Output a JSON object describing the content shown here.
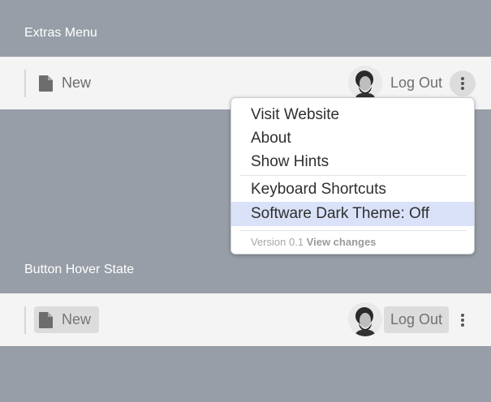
{
  "sections": [
    {
      "label": "Extras Menu",
      "new_label": "New",
      "logout_label": "Log Out",
      "menu_open": true
    },
    {
      "label": "Button Hover State",
      "new_label": "New",
      "logout_label": "Log Out",
      "menu_open": false
    }
  ],
  "dropdown": {
    "items": [
      {
        "label": "Visit Website"
      },
      {
        "label": "About"
      },
      {
        "label": "Show Hints"
      },
      {
        "label": "Keyboard Shortcuts"
      },
      {
        "label": "Software Dark Theme: Off",
        "highlighted": true
      }
    ],
    "version_text": "Version 0.1",
    "changes_link": "View changes"
  },
  "icons": {
    "new": "file-icon",
    "more": "more-vertical-icon",
    "avatar": "user-avatar"
  },
  "colors": {
    "background": "#979ea7",
    "bar": "#f4f4f4",
    "highlight": "#d9e2f8",
    "hover": "#dcdcdc"
  }
}
